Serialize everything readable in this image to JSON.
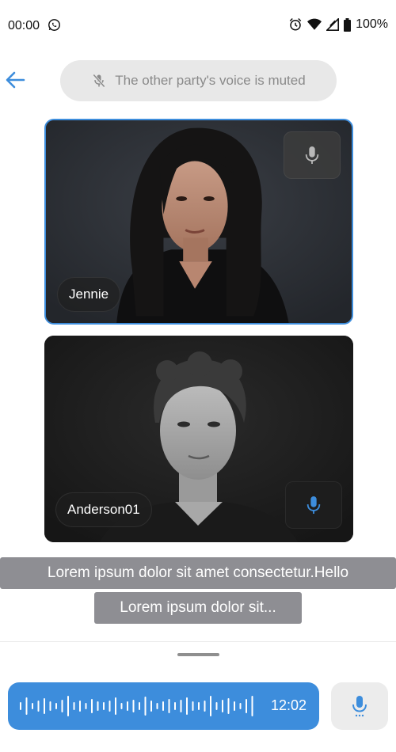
{
  "status_bar": {
    "time": "00:00",
    "battery": "100%",
    "icons": [
      "whatsapp-icon",
      "alarm-icon",
      "wifi-icon",
      "signal-icon",
      "battery-icon"
    ]
  },
  "header": {
    "back_icon": "arrow-left-icon",
    "muted_notice": "The other party's voice is muted",
    "muted_icon": "mic-off-icon"
  },
  "participants": [
    {
      "name": "Jennie",
      "active_speaker": true,
      "mic_icon": "mic-icon",
      "mic_color": "#b8b8b8"
    },
    {
      "name": "Anderson01",
      "active_speaker": false,
      "mic_icon": "mic-icon",
      "mic_color": "#3d8ddc"
    }
  ],
  "subtitles": [
    "Lorem ipsum dolor sit amet consectetur.Hello",
    "Lorem ipsum dolor sit..."
  ],
  "voice_message": {
    "duration": "12:02",
    "icon": "waveform-icon"
  },
  "mic_button": {
    "icon": "mic-icon"
  },
  "colors": {
    "accent": "#3d8ddc",
    "subtitle_bg": "#8e8e93",
    "pill_bg": "#e8e8e8"
  }
}
